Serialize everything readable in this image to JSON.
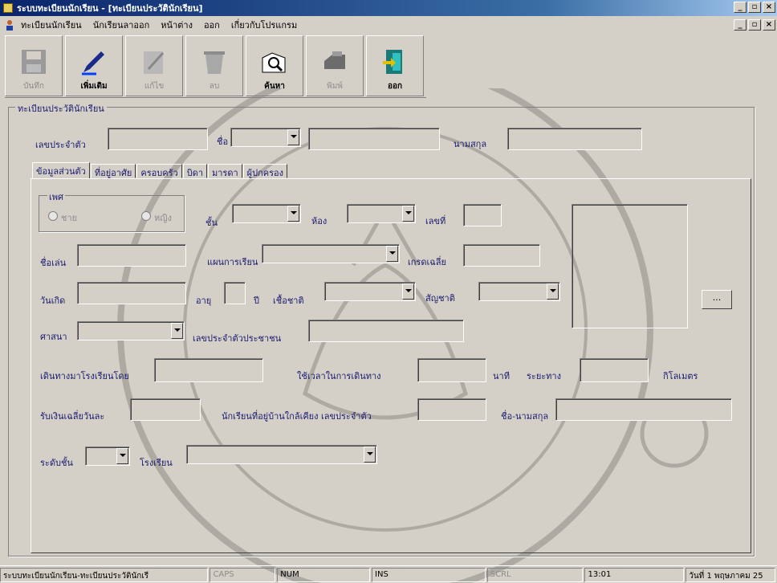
{
  "window": {
    "title": "ระบบทะเบียนนักเรียน - [ทะเบียนประวัตินักเรียน]"
  },
  "menu": {
    "items": [
      "ทะเบียนนักเรียน",
      "นักเรียนลาออก",
      "หน้าต่าง",
      "ออก",
      "เกี่ยวกับโปรแกรม"
    ]
  },
  "toolbar": {
    "save": "บันทึก",
    "add": "เพิ่มเติม",
    "edit": "แก้ไข",
    "delete": "ลบ",
    "search": "ค้นหา",
    "print": "พิมพ์",
    "exit": "ออก"
  },
  "group": {
    "title": "ทะเบียนประวัตินักเรียน"
  },
  "header": {
    "student_id_label": "เลขประจำตัว",
    "first_name_label": "ชื่อ",
    "last_name_label": "นามสกุล"
  },
  "tabs": [
    "ข้อมูลส่วนตัว",
    "ที่อยู่อาศัย",
    "ครอบครัว",
    "บิดา",
    "มารดา",
    "ผู้ปกครอง"
  ],
  "form": {
    "gender_label": "เพศ",
    "male": "ชาย",
    "female": "หญิง",
    "class_label": "ชั้น",
    "room_label": "ห้อง",
    "number_label": "เลขที่",
    "nickname_label": "ชื่อเล่น",
    "study_plan_label": "แผนการเรียน",
    "gpa_label": "เกรดเฉลี่ย",
    "birth_label": "วันเกิด",
    "age_label": "อายุ",
    "year_label": "ปี",
    "race_label": "เชื้อชาติ",
    "nationality_label": "สัญชาติ",
    "religion_label": "ศาสนา",
    "citizen_id_label": "เลขประจำตัวประชาชน",
    "travel_label": "เดินทางมาโรงเรียนโดย",
    "travel_time_label": "ใช้เวลาในการเดินทาง",
    "minutes_label": "นาที",
    "distance_label": "ระยะทาง",
    "km_label": "กิโลเมตร",
    "allowance_label": "รับเงินเฉลี่ยวันละ",
    "neighbor_label": "นักเรียนที่อยู่บ้านใกล้เคียง เลขประจำตัว",
    "neighbor_name_label": "ชื่อ-นามสกุล",
    "level_label": "ระดับชั้น",
    "school_label": "โรงเรียน",
    "browse": "..."
  },
  "status": {
    "app": "ระบบทะเบียนนักเรียน-ทะเบียนประวัตินักเรี",
    "caps": "CAPS",
    "num": "NUM",
    "ins": "INS",
    "scrl": "SCRL",
    "time": "13:01",
    "date": "วันที่ 1 พฤษภาคม 25"
  }
}
